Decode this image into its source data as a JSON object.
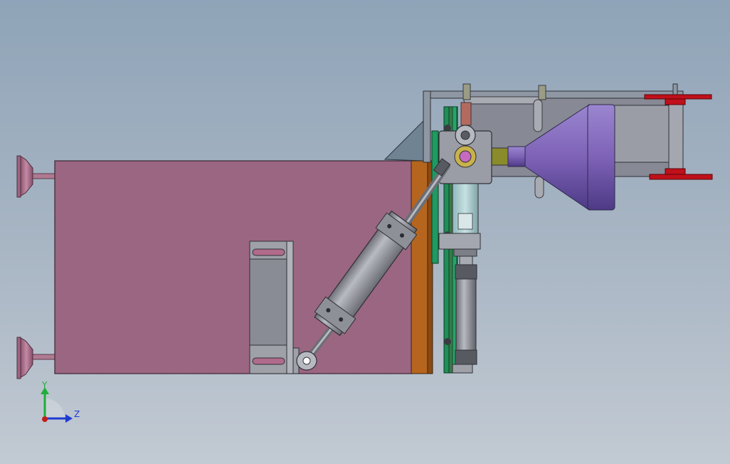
{
  "view": {
    "background_top": "#8fa4b8",
    "background_bottom": "#c2cad3"
  },
  "triad": {
    "y_label": "Y",
    "z_label": "Z",
    "y_color": "#1fae3a",
    "z_color": "#1f3bd1",
    "origin_color": "#c0201c"
  },
  "colors": {
    "main_body": "#9b6682",
    "copper_plate": "#b5651d",
    "green_plate": "#1f9a60",
    "steel": "#8c8e96",
    "horn": "#7e62b6",
    "red_parts": "#c0101a"
  }
}
